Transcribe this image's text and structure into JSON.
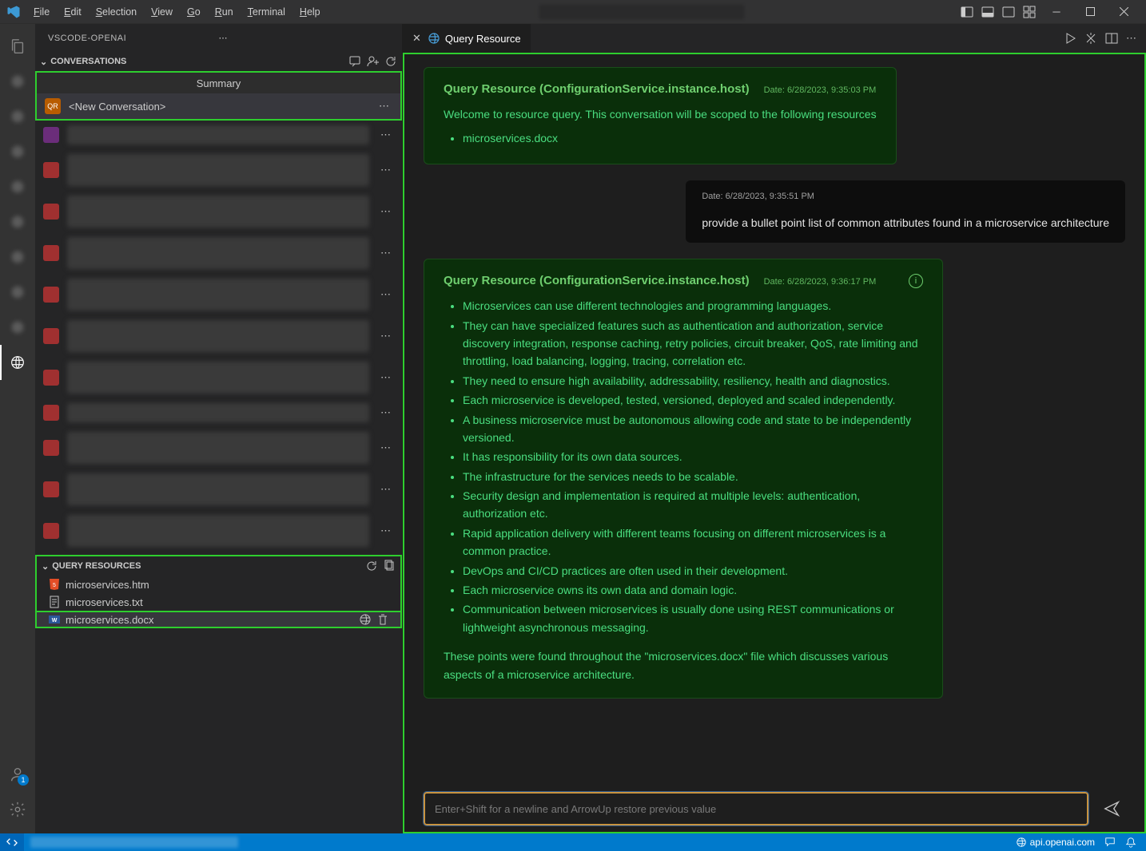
{
  "menus": {
    "file": "File",
    "edit": "Edit",
    "selection": "Selection",
    "view": "View",
    "go": "Go",
    "run": "Run",
    "terminal": "Terminal",
    "help": "Help"
  },
  "sidebar": {
    "title": "VSCODE-OPENAI",
    "section_conversations": "CONVERSATIONS",
    "summary_label": "Summary",
    "new_conv": "<New Conversation>",
    "section_resources": "QUERY RESOURCES",
    "resources": {
      "r0": "microservices.htm",
      "r1": "microservices.txt",
      "r2": "microservices.docx"
    }
  },
  "tab": {
    "label": "Query Resource"
  },
  "chat": {
    "m1_title": "Query Resource (ConfigurationService.instance.host)",
    "m1_date": "Date: 6/28/2023, 9:35:03 PM",
    "m1_body": "Welcome to resource query. This conversation will be scoped to the following resources",
    "m1_li1": "microservices.docx",
    "m2_date": "Date: 6/28/2023, 9:35:51 PM",
    "m2_body": "provide a bullet point list of common attributes found in a microservice architecture",
    "m3_title": "Query Resource (ConfigurationService.instance.host)",
    "m3_date": "Date: 6/28/2023, 9:36:17 PM",
    "m3_li1": "Microservices can use different technologies and programming languages.",
    "m3_li2": "They can have specialized features such as authentication and authorization, service discovery integration, response caching, retry policies, circuit breaker, QoS, rate limiting and throttling, load balancing, logging, tracing, correlation etc.",
    "m3_li3": "They need to ensure high availability, addressability, resiliency, health and diagnostics.",
    "m3_li4": "Each microservice is developed, tested, versioned, deployed and scaled independently.",
    "m3_li5": "A business microservice must be autonomous allowing code and state to be independently versioned.",
    "m3_li6": "It has responsibility for its own data sources.",
    "m3_li7": "The infrastructure for the services needs to be scalable.",
    "m3_li8": "Security design and implementation is required at multiple levels: authentication, authorization etc.",
    "m3_li9": "Rapid application delivery with different teams focusing on different microservices is a common practice.",
    "m3_li10": "DevOps and CI/CD practices are often used in their development.",
    "m3_li11": "Each microservice owns its own data and domain logic.",
    "m3_li12": "Communication between microservices is usually done using REST communications or lightweight asynchronous messaging.",
    "m3_footer": "These points were found throughout the \"microservices.docx\" file which discusses various aspects of a microservice architecture.",
    "placeholder": "Enter+Shift for a newline and ArrowUp restore previous value"
  },
  "status": {
    "api": "api.openai.com"
  }
}
